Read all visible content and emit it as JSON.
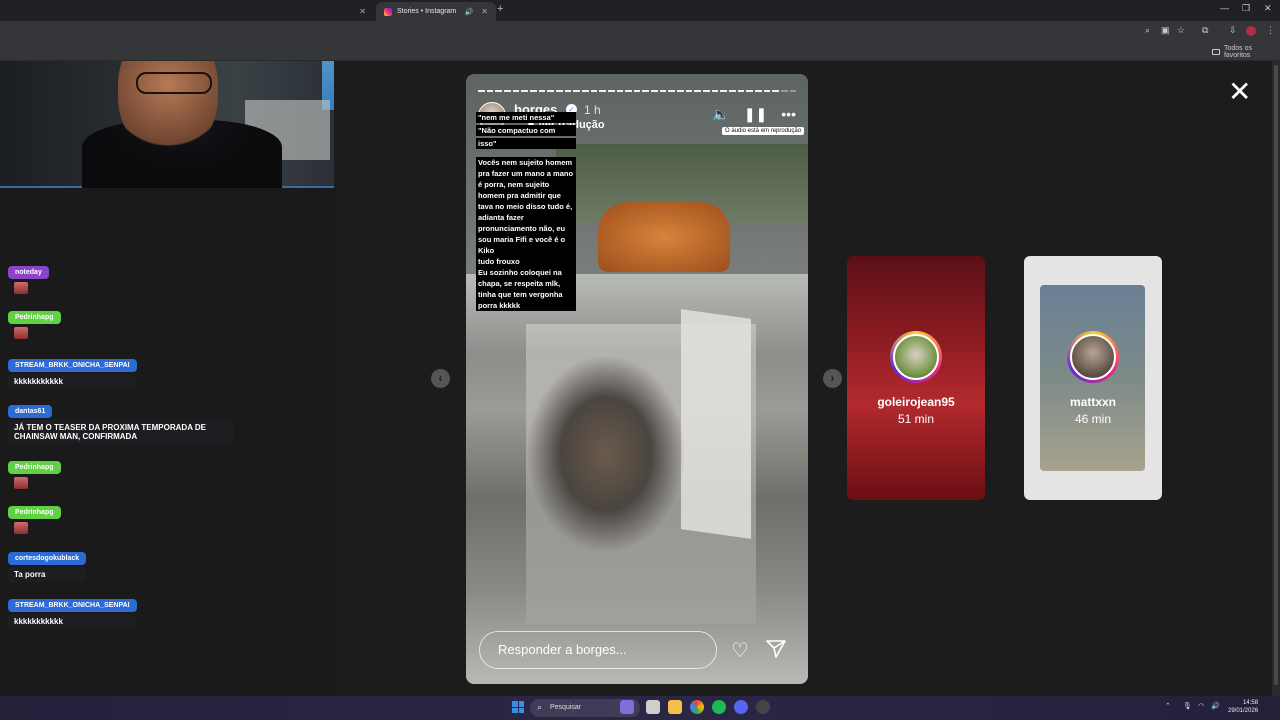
{
  "browser": {
    "tabs": [
      {
        "label": "",
        "active": false
      },
      {
        "label": "Stories • Instagram",
        "active": true
      }
    ],
    "bookmarks_folder": "Todos os favoritos"
  },
  "story": {
    "username": "borges",
    "time": "1 h",
    "translate_label": "Ver tradução",
    "audio_tooltip": "O áudio está em reprodução",
    "reply_placeholder": "Responder a borges...",
    "captions_top": [
      "\"nem me meti nessa\"",
      "\"Não compactuo com",
      "isso\""
    ],
    "captions_main": [
      "Vocês nem sujeito homem",
      "pra fazer um mano a mano",
      "é porra, nem sujeito",
      "homem pra admitir que",
      "tava no meio disso tudo é,",
      "adianta fazer",
      "pronunciamento não, eu",
      "sou maria Fifi e você é o",
      "Kiko",
      "tudo frouxo",
      "Eu sozinho coloquei na",
      "chapa, se respeita mlk,",
      "tinha que tem vergonha",
      "porra kkkkk"
    ]
  },
  "side_stories": [
    {
      "username": "goleirojean95",
      "time": "51 min"
    },
    {
      "username": "mattxxn",
      "time": "46 min"
    }
  ],
  "chat": [
    {
      "user": "noteday",
      "text": "",
      "color": "purple",
      "emote": true
    },
    {
      "user": "Pedrinhapg",
      "text": "",
      "color": "green",
      "emote": true
    },
    {
      "user": "STREAM_BRKK_ONICHA_SENPAI",
      "text": "kkkkkkkkkkk",
      "color": "blue",
      "emote": false
    },
    {
      "user": "dantas61",
      "text": "JÁ TEM O TEASER DA PROXIMA TEMPORADA DE CHAINSAW MAN, CONFIRMADA",
      "color": "blue",
      "emote": false
    },
    {
      "user": "Pedrinhapg",
      "text": "",
      "color": "green",
      "emote": true
    },
    {
      "user": "Pedrinhapg",
      "text": "",
      "color": "green",
      "emote": true
    },
    {
      "user": "cortesdogokublack",
      "text": "Ta porra",
      "color": "blue",
      "emote": false
    },
    {
      "user": "STREAM_BRKK_ONICHA_SENPAI",
      "text": "kkkkkkkkkkk",
      "color": "blue",
      "emote": false
    }
  ],
  "taskbar": {
    "search_placeholder": "Pesquisar",
    "time": "14:58",
    "date": "29/01/2026"
  }
}
